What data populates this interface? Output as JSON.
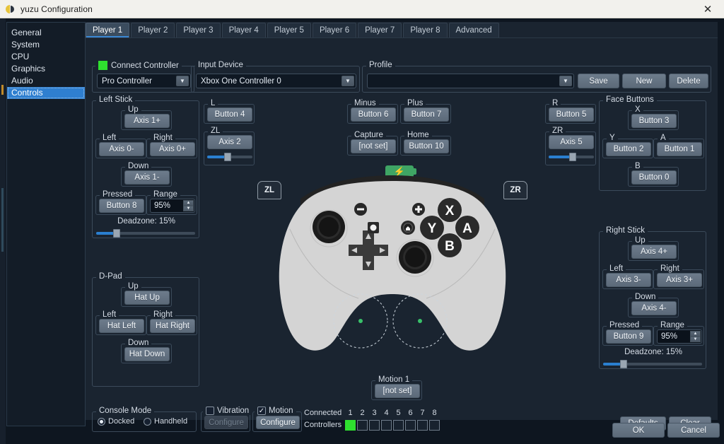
{
  "window": {
    "title": "yuzu Configuration",
    "close_icon": "close-icon"
  },
  "sidebar": {
    "items": [
      {
        "label": "General",
        "selected": false
      },
      {
        "label": "System",
        "selected": false
      },
      {
        "label": "CPU",
        "selected": false
      },
      {
        "label": "Graphics",
        "selected": false
      },
      {
        "label": "Audio",
        "selected": false
      },
      {
        "label": "Controls",
        "selected": true
      }
    ]
  },
  "tabs": [
    {
      "label": "Player 1",
      "active": true
    },
    {
      "label": "Player 2",
      "active": false
    },
    {
      "label": "Player 3",
      "active": false
    },
    {
      "label": "Player 4",
      "active": false
    },
    {
      "label": "Player 5",
      "active": false
    },
    {
      "label": "Player 6",
      "active": false
    },
    {
      "label": "Player 7",
      "active": false
    },
    {
      "label": "Player 8",
      "active": false
    },
    {
      "label": "Advanced",
      "active": false
    }
  ],
  "connect_controller": {
    "label": "Connect Controller",
    "indicator_color": "#2fe02f",
    "controller_type": "Pro Controller"
  },
  "input_device": {
    "label": "Input Device",
    "value": "Xbox One Controller 0"
  },
  "profile": {
    "label": "Profile",
    "value": "",
    "save_label": "Save",
    "new_label": "New",
    "delete_label": "Delete"
  },
  "left_stick": {
    "title": "Left Stick",
    "up_label": "Up",
    "up_value": "Axis 1+",
    "left_label": "Left",
    "left_value": "Axis 0-",
    "right_label": "Right",
    "right_value": "Axis 0+",
    "down_label": "Down",
    "down_value": "Axis 1-",
    "pressed_label": "Pressed",
    "pressed_value": "Button 8",
    "range_label": "Range",
    "range_value": "95%",
    "deadzone_label": "Deadzone: 15%",
    "deadzone_percent": 15
  },
  "right_stick": {
    "title": "Right Stick",
    "up_label": "Up",
    "up_value": "Axis 4+",
    "left_label": "Left",
    "left_value": "Axis 3-",
    "right_label": "Right",
    "right_value": "Axis 3+",
    "down_label": "Down",
    "down_value": "Axis 4-",
    "pressed_label": "Pressed",
    "pressed_value": "Button 9",
    "range_label": "Range",
    "range_value": "95%",
    "deadzone_label": "Deadzone: 15%",
    "deadzone_percent": 15
  },
  "dpad": {
    "title": "D-Pad",
    "up_label": "Up",
    "up_value": "Hat Up",
    "left_label": "Left",
    "left_value": "Hat Left",
    "right_label": "Right",
    "right_value": "Hat Right",
    "down_label": "Down",
    "down_value": "Hat Down"
  },
  "shoulder_left": {
    "l_label": "L",
    "l_value": "Button 4",
    "zl_label": "ZL",
    "zl_value": "Axis 2",
    "zl_slider_percent": 42
  },
  "shoulder_right": {
    "r_label": "R",
    "r_value": "Button 5",
    "zr_label": "ZR",
    "zr_value": "Axis 5",
    "zr_slider_percent": 50
  },
  "misc_buttons": {
    "minus_label": "Minus",
    "minus_value": "Button 6",
    "plus_label": "Plus",
    "plus_value": "Button 7",
    "capture_label": "Capture",
    "capture_value": "[not set]",
    "home_label": "Home",
    "home_value": "Button 10"
  },
  "face_buttons": {
    "title": "Face Buttons",
    "x_label": "X",
    "x_value": "Button 3",
    "y_label": "Y",
    "y_value": "Button 2",
    "a_label": "A",
    "a_value": "Button 1",
    "b_label": "B",
    "b_value": "Button 0"
  },
  "motion": {
    "motion1_label": "Motion 1",
    "motion1_value": "[not set]"
  },
  "console_mode": {
    "title": "Console Mode",
    "docked_label": "Docked",
    "handheld_label": "Handheld",
    "selected": "Docked"
  },
  "vibration": {
    "label": "Vibration",
    "checked": false,
    "configure_label": "Configure",
    "configure_enabled": false
  },
  "motion_toggle": {
    "label": "Motion",
    "checked": true,
    "configure_label": "Configure",
    "configure_enabled": true
  },
  "connected_controllers": {
    "line1": "Connected",
    "line2": "Controllers",
    "numbers": [
      "1",
      "2",
      "3",
      "4",
      "5",
      "6",
      "7",
      "8"
    ],
    "states": [
      true,
      false,
      false,
      false,
      false,
      false,
      false,
      false
    ]
  },
  "footer": {
    "defaults_label": "Defaults",
    "clear_label": "Clear",
    "ok_label": "OK",
    "cancel_label": "Cancel"
  },
  "controller_art": {
    "zl_label": "ZL",
    "zr_label": "ZR",
    "face_x": "X",
    "face_y": "Y",
    "face_a": "A",
    "face_b": "B",
    "minus_glyph": "−",
    "plus_glyph": "+",
    "battery_icon": "battery-charging-icon",
    "home_icon": "home-icon",
    "capture_icon": "capture-icon",
    "body_color": "#d4d4d4",
    "accent_color": "#2a7fd0"
  }
}
